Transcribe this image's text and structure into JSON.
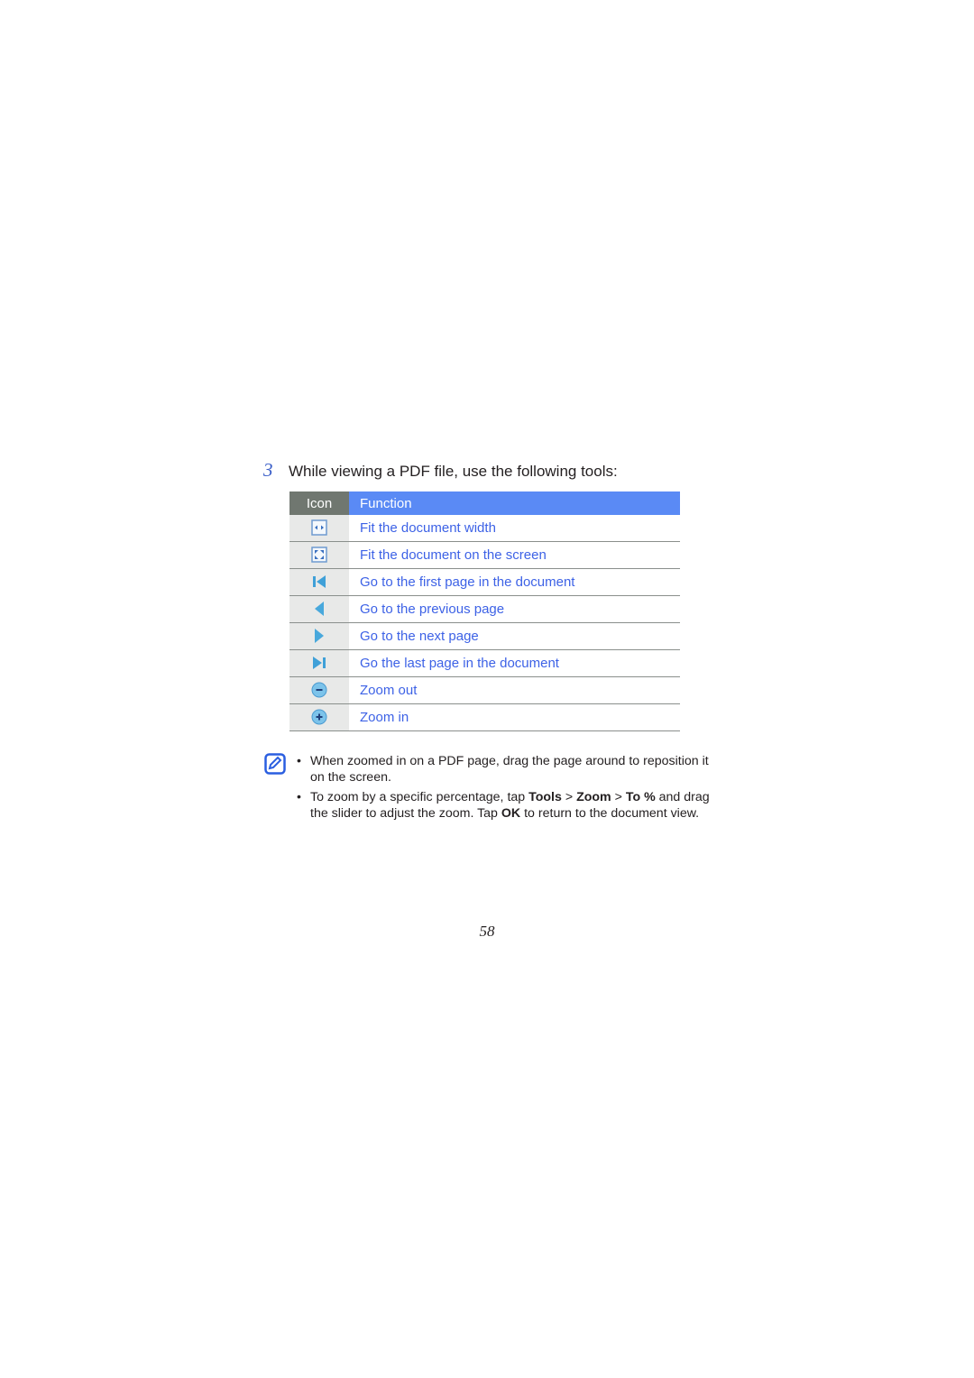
{
  "step": {
    "number": "3",
    "text": "While viewing a PDF file, use the following tools:"
  },
  "table": {
    "headers": {
      "icon": "Icon",
      "function": "Function"
    },
    "rows": [
      {
        "icon": "fit-width-icon",
        "function": "Fit the document width"
      },
      {
        "icon": "fit-screen-icon",
        "function": "Fit the document on the screen"
      },
      {
        "icon": "first-page-icon",
        "function": "Go to the first page in the document"
      },
      {
        "icon": "previous-page-icon",
        "function": "Go to the previous page"
      },
      {
        "icon": "next-page-icon",
        "function": "Go to the next page"
      },
      {
        "icon": "last-page-icon",
        "function": "Go the last page in the document"
      },
      {
        "icon": "zoom-out-icon",
        "function": "Zoom out"
      },
      {
        "icon": "zoom-in-icon",
        "function": "Zoom in"
      }
    ]
  },
  "note": {
    "icon": "note-icon",
    "bullet1": "When zoomed in on a PDF page, drag the page around to reposition it on the screen.",
    "bullet2": {
      "pre": "To zoom by a specific percentage, tap ",
      "tools": "Tools",
      "sep1": " > ",
      "zoom": "Zoom",
      "sep2": " > ",
      "to_pct": "To %",
      "mid": " and drag the slider to adjust the zoom. Tap ",
      "ok": "OK",
      "post": " to return to the document view."
    }
  },
  "page_number": "58",
  "colors": {
    "accent_blue": "#5a8af5",
    "link_blue": "#3d62e6",
    "header_gray": "#707770"
  }
}
